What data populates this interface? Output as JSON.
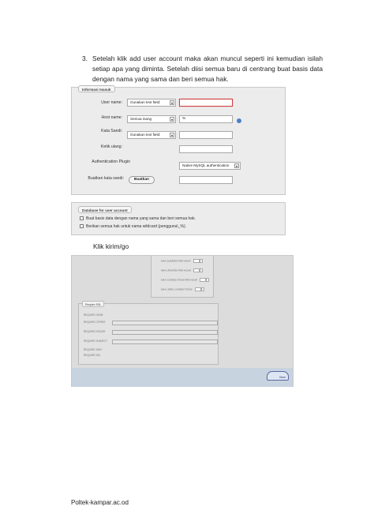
{
  "step": {
    "number": "3.",
    "text": "Setelah klik add user account maka akan muncul seperti ini kemudian isilah setiap apa yang diminta. Setelah diisi semua baru di centrang buat basis data dengan nama yang sama dan beri semua hak."
  },
  "login_form": {
    "legend": "Informasi masuk",
    "rows": [
      {
        "label": "User name:",
        "select": "Gunakan text field:",
        "value": ""
      },
      {
        "label": "Host name:",
        "select": "Semua inang",
        "value": "%"
      },
      {
        "label": "Kata Sandi:",
        "select": "Gunakan text field:",
        "value": ""
      },
      {
        "label": "Ketik ulang:",
        "select": "",
        "value": ""
      }
    ],
    "auth_label": "Authentication Plugin",
    "auth_value": "Native MySQL authentication",
    "generate_label": "Buatkan kata sandi:",
    "generate_button": "Buatkan"
  },
  "db_form": {
    "legend": "Database for user account",
    "options": [
      "Buat basis data dengan nama yang sama dan beri semua hak.",
      "Berikan semua hak untuk nama wildcard (pengguna\\_%)."
    ]
  },
  "klik": "Klik kirim/go",
  "resource_limits": [
    {
      "label": "MAX QUERIES PER HOUR",
      "value": "0"
    },
    {
      "label": "MAX UPDATES PER HOUR",
      "value": "0"
    },
    {
      "label": "MAX CONNECTIONS PER HOUR",
      "value": "0"
    },
    {
      "label": "MAX USER_CONNECTIONS",
      "value": "0"
    }
  ],
  "ssl": {
    "legend": "Require SSL",
    "items": [
      "REQUIRE NONE",
      "REQUIRE CIPHER",
      "REQUIRE ISSUER",
      "REQUIRE SUBJECT",
      "REQUIRE X509",
      "REQUIRE SSL"
    ]
  },
  "go_button": "Kirim",
  "footer": "Poltek-kampar.ac.od"
}
